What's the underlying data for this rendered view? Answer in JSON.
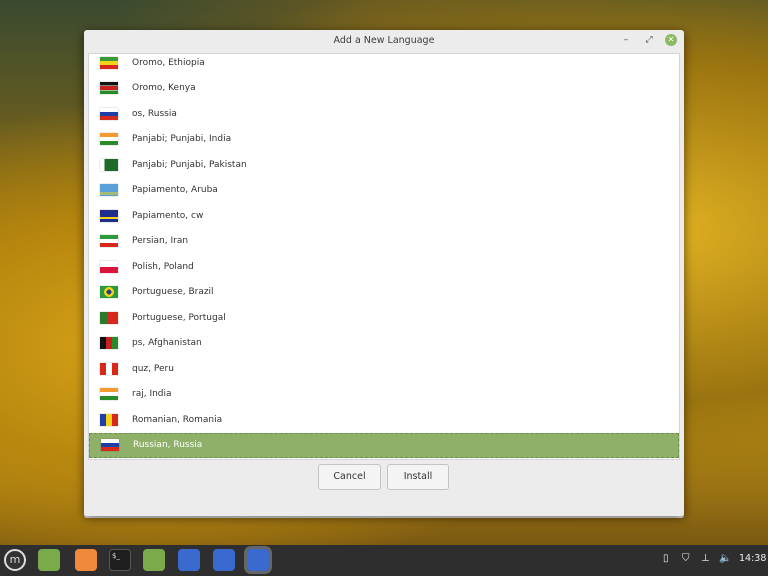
{
  "dialog": {
    "title": "Add a New Language",
    "minimize": "–",
    "maximize": "⤢",
    "close": "✕"
  },
  "languages": [
    {
      "label": "Oromo, Ethiopia",
      "flag": "linear-gradient(#3a9a3a 33%,#f2d21a 33% 66%,#d8281c 66%)"
    },
    {
      "label": "Oromo, Kenya",
      "flag": "linear-gradient(#111 30%,#fff 30% 35%,#c8201c 35% 65%,#fff 65% 70%,#2a8a2a 70%)"
    },
    {
      "label": "os, Russia",
      "flag": "linear-gradient(#fff 33%,#1e3ea8 33% 66%,#d52b1e 66%)"
    },
    {
      "label": "Panjabi; Punjabi, India",
      "flag": "linear-gradient(#f49a30 33%,#fff 33% 66%,#2a8a2a 66%)"
    },
    {
      "label": "Panjabi; Punjabi, Pakistan",
      "flag": "linear-gradient(90deg,#fff 25%,#1e6a2a 25%)"
    },
    {
      "label": "Papiamento, Aruba",
      "flag": "linear-gradient(#5aa0d8 65%,#f2d21a 65% 72%,#5aa0d8 72% 80%,#f2d21a 80% 87%,#5aa0d8 87%)"
    },
    {
      "label": "Papiamento, cw",
      "flag": "linear-gradient(#1e2e8a 60%,#f2d21a 60% 75%,#1e2e8a 75%)"
    },
    {
      "label": "Persian, Iran",
      "flag": "linear-gradient(#2a9a3a 33%,#fff 33% 66%,#d8281c 66%)"
    },
    {
      "label": "Polish, Poland",
      "flag": "linear-gradient(#fff 50%,#dc143c 50%)"
    },
    {
      "label": "Portuguese, Brazil",
      "flag": "radial-gradient(circle,#1e3e8a 22%,#f2d21a 23% 45%,#2a9a3a 46%)"
    },
    {
      "label": "Portuguese, Portugal",
      "flag": "linear-gradient(90deg,#2a7a2a 40%,#d8281c 40%)"
    },
    {
      "label": "ps, Afghanistan",
      "flag": "linear-gradient(90deg,#111 33%,#c8201c 33% 66%,#2a8a2a 66%)"
    },
    {
      "label": "quz, Peru",
      "flag": "linear-gradient(90deg,#d8281c 33%,#fff 33% 66%,#d8281c 66%)"
    },
    {
      "label": "raj, India",
      "flag": "linear-gradient(#f49a30 33%,#fff 33% 66%,#2a8a2a 66%)"
    },
    {
      "label": "Romanian, Romania",
      "flag": "linear-gradient(90deg,#1e3ea8 33%,#f2d21a 33% 66%,#d8281c 66%)"
    },
    {
      "label": "Russian, Russia",
      "flag": "linear-gradient(#fff 33%,#1e3ea8 33% 66%,#d52b1e 66%)",
      "selected": true
    }
  ],
  "buttons": {
    "cancel": "Cancel",
    "install": "Install"
  },
  "taskbar": {
    "clock": "14:38"
  }
}
